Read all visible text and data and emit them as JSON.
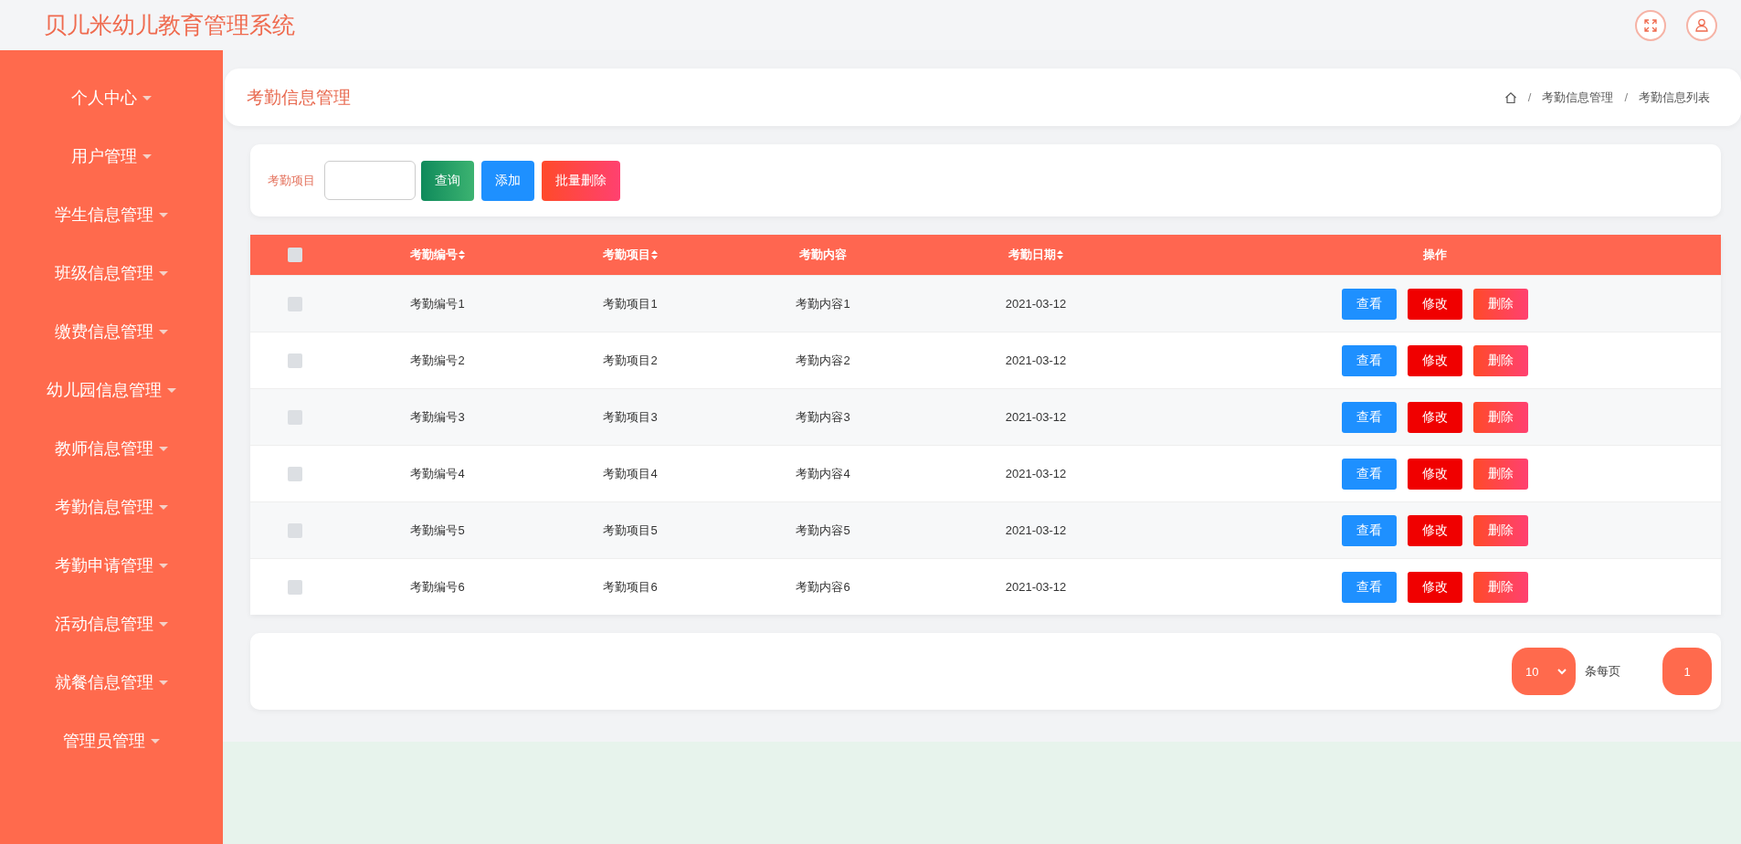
{
  "header": {
    "title": "贝儿米幼儿教育管理系统"
  },
  "sidebar": {
    "items": [
      {
        "label": "个人中心"
      },
      {
        "label": "用户管理"
      },
      {
        "label": "学生信息管理"
      },
      {
        "label": "班级信息管理"
      },
      {
        "label": "缴费信息管理"
      },
      {
        "label": "幼儿园信息管理"
      },
      {
        "label": "教师信息管理"
      },
      {
        "label": "考勤信息管理"
      },
      {
        "label": "考勤申请管理"
      },
      {
        "label": "活动信息管理"
      },
      {
        "label": "就餐信息管理"
      },
      {
        "label": "管理员管理"
      }
    ]
  },
  "page_title": "考勤信息管理",
  "breadcrumb": [
    {
      "separator": "/",
      "label": "考勤信息管理"
    },
    {
      "separator": "/",
      "label": "考勤信息列表"
    }
  ],
  "search": {
    "label": "考勤项目",
    "buttons": [
      {
        "label": "查询",
        "kind": "query"
      },
      {
        "label": "添加",
        "kind": "add"
      },
      {
        "label": "批量删除",
        "kind": "delete"
      }
    ]
  },
  "table": {
    "header_checked": false,
    "columns": [
      {
        "label": "考勤编号",
        "sortable": true
      },
      {
        "label": "考勤项目",
        "sortable": true
      },
      {
        "label": "考勤内容",
        "sortable": false
      },
      {
        "label": "考勤日期",
        "sortable": true
      },
      {
        "label": "操作",
        "sortable": false
      }
    ],
    "rows": [
      {
        "checked": false,
        "cells": [
          "考勤编号1",
          "考勤项目1",
          "考勤内容1",
          "2021-03-12"
        ],
        "actions": [
          {
            "label": "查看",
            "kind": "view"
          },
          {
            "label": "修改",
            "kind": "edit"
          },
          {
            "label": "删除",
            "kind": "delete"
          }
        ]
      },
      {
        "checked": false,
        "cells": [
          "考勤编号2",
          "考勤项目2",
          "考勤内容2",
          "2021-03-12"
        ],
        "actions": [
          {
            "label": "查看",
            "kind": "view"
          },
          {
            "label": "修改",
            "kind": "edit"
          },
          {
            "label": "删除",
            "kind": "delete"
          }
        ]
      },
      {
        "checked": false,
        "cells": [
          "考勤编号3",
          "考勤项目3",
          "考勤内容3",
          "2021-03-12"
        ],
        "actions": [
          {
            "label": "查看",
            "kind": "view"
          },
          {
            "label": "修改",
            "kind": "edit"
          },
          {
            "label": "删除",
            "kind": "delete"
          }
        ]
      },
      {
        "checked": false,
        "cells": [
          "考勤编号4",
          "考勤项目4",
          "考勤内容4",
          "2021-03-12"
        ],
        "actions": [
          {
            "label": "查看",
            "kind": "view"
          },
          {
            "label": "修改",
            "kind": "edit"
          },
          {
            "label": "删除",
            "kind": "delete"
          }
        ]
      },
      {
        "checked": false,
        "cells": [
          "考勤编号5",
          "考勤项目5",
          "考勤内容5",
          "2021-03-12"
        ],
        "actions": [
          {
            "label": "查看",
            "kind": "view"
          },
          {
            "label": "修改",
            "kind": "edit"
          },
          {
            "label": "删除",
            "kind": "delete"
          }
        ]
      },
      {
        "checked": false,
        "cells": [
          "考勤编号6",
          "考勤项目6",
          "考勤内容6",
          "2021-03-12"
        ],
        "actions": [
          {
            "label": "查看",
            "kind": "view"
          },
          {
            "label": "修改",
            "kind": "edit"
          },
          {
            "label": "删除",
            "kind": "delete"
          }
        ]
      }
    ]
  },
  "pagination": {
    "page_size": "10",
    "page_size_label": "条每页",
    "pages": [
      {
        "label": "1",
        "selected": true
      }
    ]
  }
}
